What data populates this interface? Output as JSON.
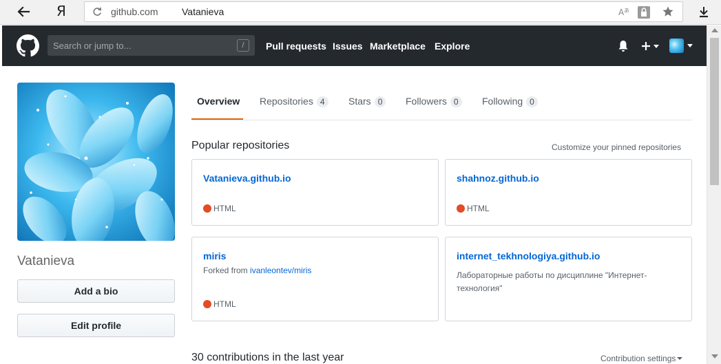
{
  "browser": {
    "back_icon": "left-arrow-icon",
    "yandex_label": "Я",
    "url_domain": "github.com",
    "url_page": "Vatanieva",
    "download_icon": "download-icon"
  },
  "header": {
    "search_placeholder": "Search or jump to...",
    "search_shortcut": "/",
    "nav": [
      "Pull requests",
      "Issues",
      "Marketplace",
      "Explore"
    ],
    "plus_label": "+",
    "background": "#24292e"
  },
  "profile": {
    "name": "Vatanieva",
    "add_bio": "Add a bio",
    "edit_profile": "Edit profile"
  },
  "tabs": [
    {
      "label": "Overview",
      "count": null
    },
    {
      "label": "Repositories",
      "count": "4"
    },
    {
      "label": "Stars",
      "count": "0"
    },
    {
      "label": "Followers",
      "count": "0"
    },
    {
      "label": "Following",
      "count": "0"
    }
  ],
  "popular": {
    "title": "Popular repositories",
    "customize": "Customize your pinned repositories"
  },
  "repos": [
    {
      "name": "Vatanieva.github.io",
      "language": "HTML"
    },
    {
      "name": "shahnoz.github.io",
      "language": "HTML"
    },
    {
      "name": "miris",
      "fork_prefix": "Forked from",
      "fork_source": "ivanleontev/miris",
      "language": "HTML"
    },
    {
      "name": "internet_tekhnologiya.github.io",
      "description": "Лабораторные работы по дисциплине \"Интернет-технология\""
    }
  ],
  "contributions": {
    "title": "30 contributions in the last year",
    "settings": "Contribution settings"
  },
  "colors": {
    "accent_tab": "#e36209",
    "link": "#0366d6",
    "html_lang": "#e34c26"
  }
}
